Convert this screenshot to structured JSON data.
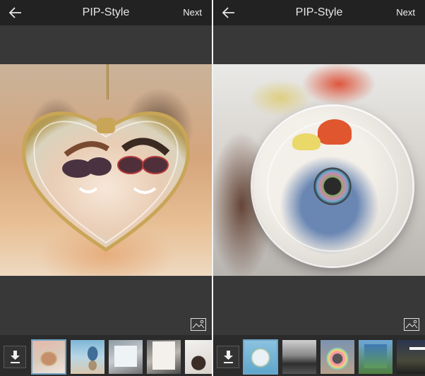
{
  "screens": [
    {
      "appbar": {
        "title": "PIP-Style",
        "back_icon": "arrow-left-icon",
        "next_label": "Next"
      },
      "preview": {
        "frame_style": "heart-crystal-pendant"
      },
      "gallery_icon": "image-icon",
      "download_icon": "download-icon",
      "thumbnails": [
        {
          "name": "heart-pendant-frame",
          "selected": true
        },
        {
          "name": "hourglass-frame",
          "selected": false
        },
        {
          "name": "photo-square-frame",
          "selected": false
        },
        {
          "name": "polaroid-lips-frame",
          "selected": false
        },
        {
          "name": "magnifier-frame",
          "selected": false
        }
      ]
    },
    {
      "appbar": {
        "title": "PIP-Style",
        "back_icon": "arrow-left-icon",
        "next_label": "Next"
      },
      "preview": {
        "frame_style": "cd-disc-earphones"
      },
      "gallery_icon": "image-icon",
      "download_icon": "download-icon",
      "thumbnails": [
        {
          "name": "cd-disc-frame",
          "selected": true
        },
        {
          "name": "monochrome-room-frame",
          "selected": false
        },
        {
          "name": "flower-circle-frame",
          "selected": false
        },
        {
          "name": "stamp-frame-hand",
          "selected": false
        },
        {
          "name": "polaroid-sunset-frame",
          "selected": false
        }
      ]
    }
  ],
  "colors": {
    "appbar_bg": "#222222",
    "body_bg": "#383838",
    "strip_bg": "#2b2b2b",
    "selected_outline": "#6fa6c8",
    "text": "#e6e6e6"
  }
}
